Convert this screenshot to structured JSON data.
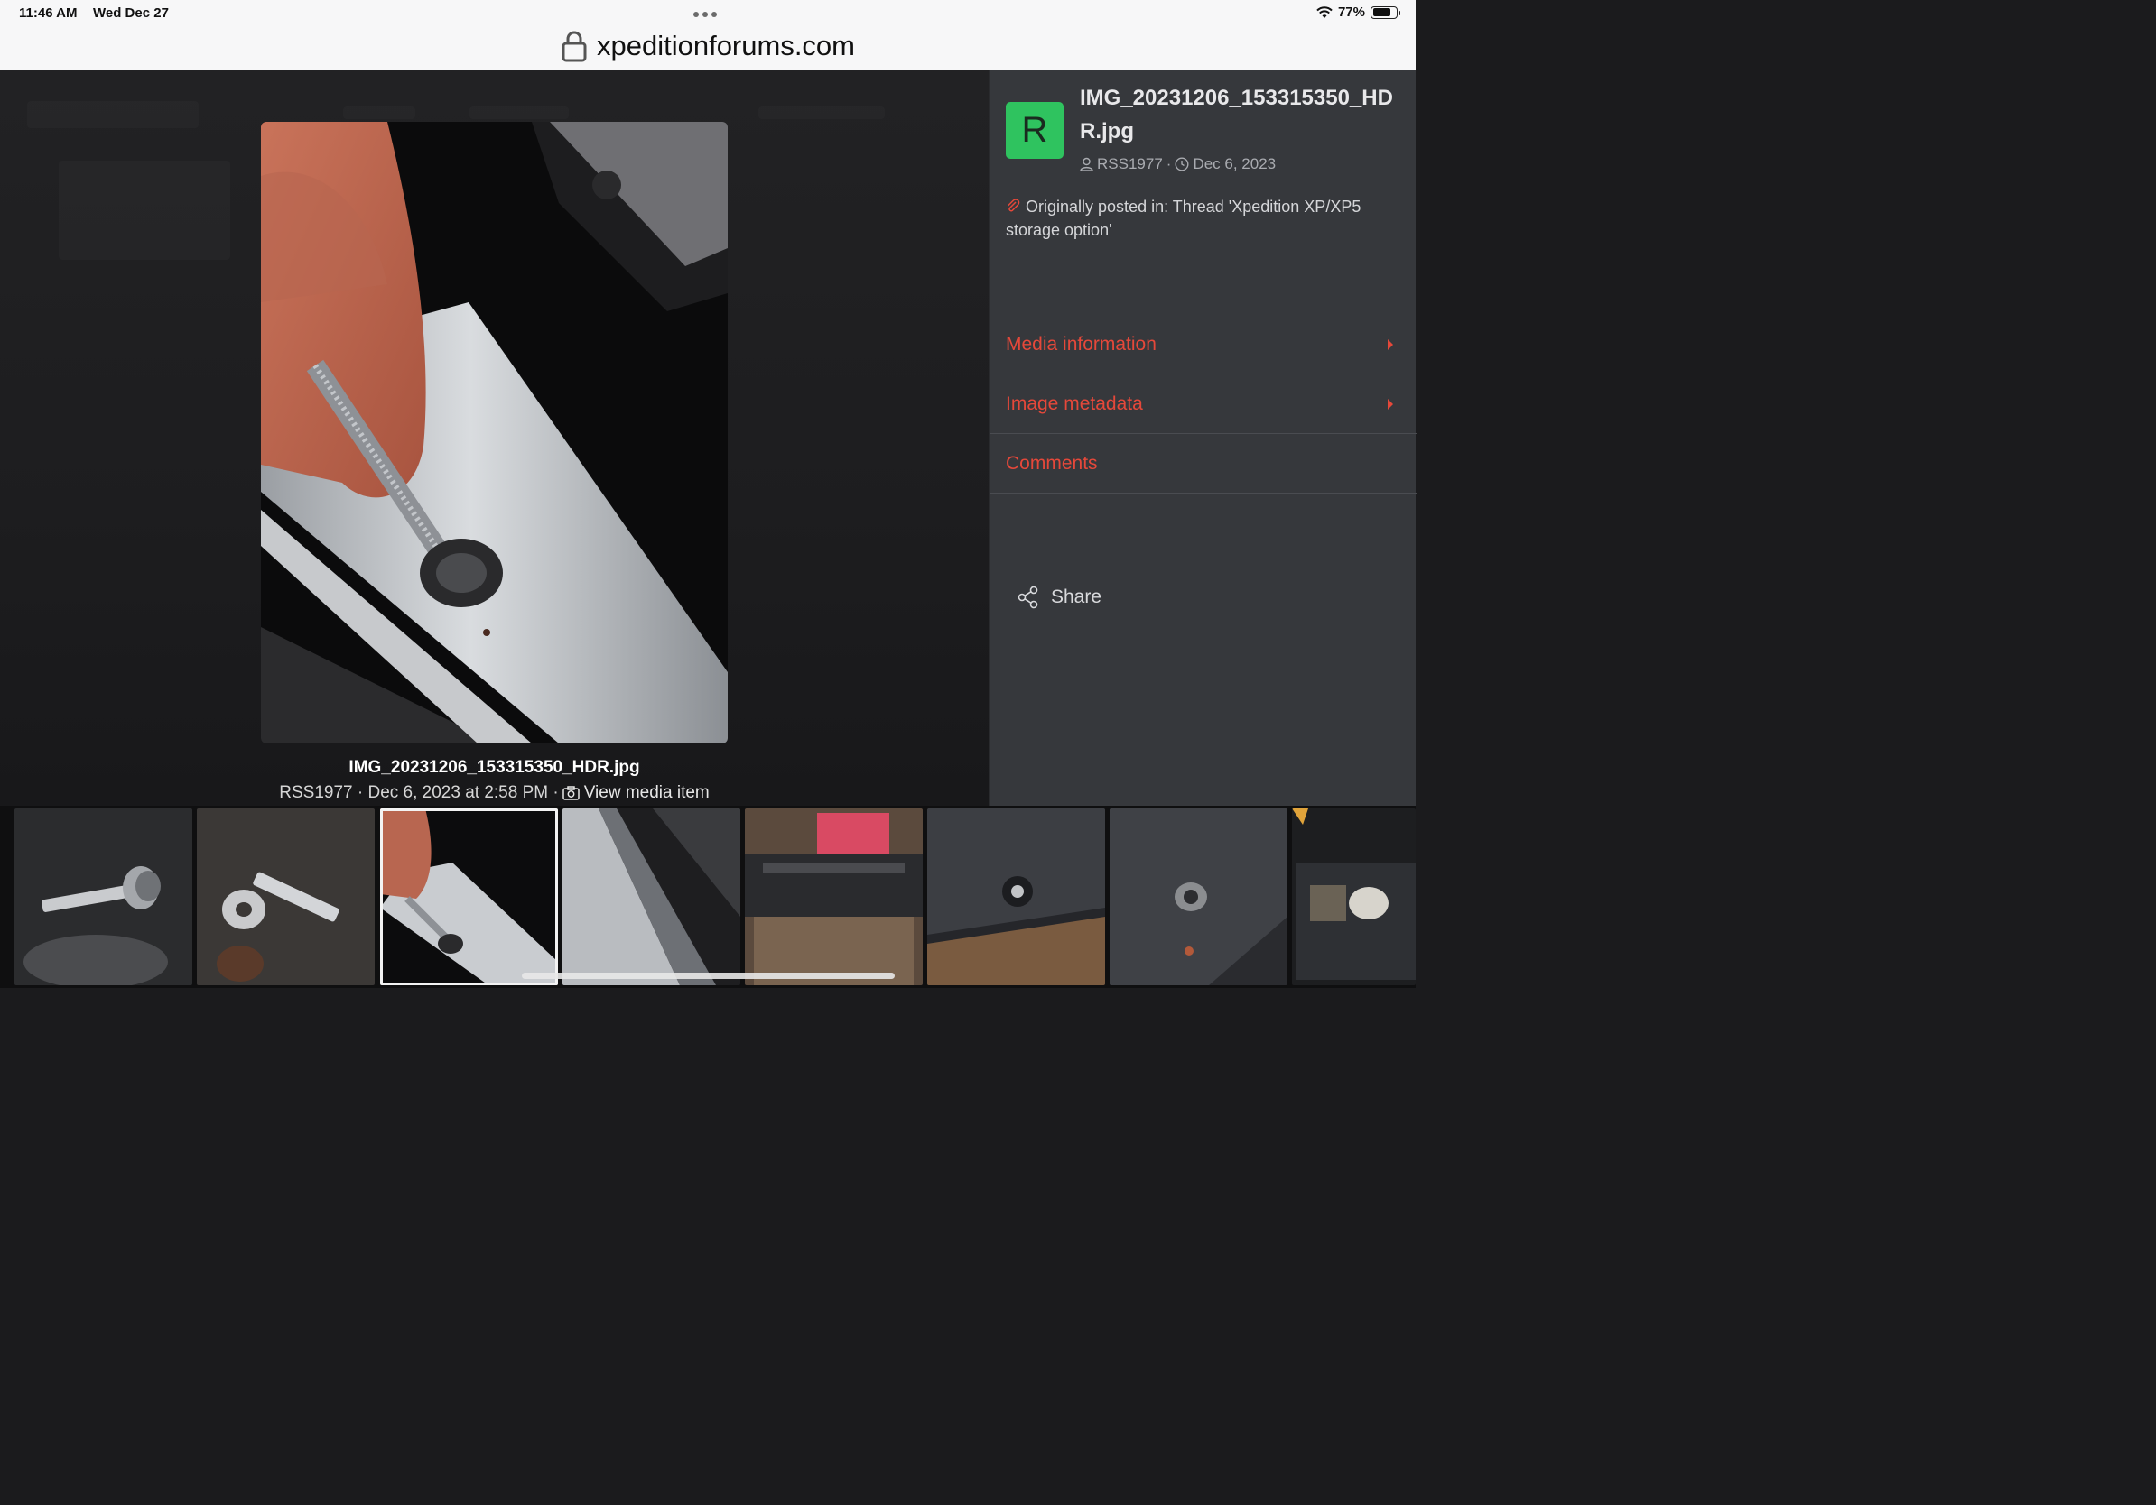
{
  "status_bar": {
    "time": "11:46 AM",
    "date": "Wed Dec 27",
    "battery": "77%"
  },
  "browser": {
    "url": "xpeditionforums.com"
  },
  "viewer": {
    "caption_title": "IMG_20231206_153315350_HDR.jpg",
    "caption_meta": "RSS1977 · Dec 6, 2023 at 2:58 PM ·",
    "view_media_label": "View media item"
  },
  "sidebar": {
    "avatar_letter": "R",
    "avatar_color": "#2fc35f",
    "title": "IMG_20231206_153315350_HDR.jpg",
    "author": "RSS1977",
    "separator": "·",
    "date": "Dec 6, 2023",
    "origin_text": "Originally posted in: Thread 'Xpedition XP/XP5 storage option'",
    "rows": [
      {
        "label": "Media information"
      },
      {
        "label": "Image metadata"
      },
      {
        "label": "Comments"
      }
    ],
    "share_label": "Share",
    "accent_color": "#e5483a"
  },
  "filmstrip": {
    "selected_index": 2,
    "thumbnails": [
      {
        "name": "thumb-bolt-washers"
      },
      {
        "name": "thumb-bolt-loose-parts"
      },
      {
        "name": "thumb-bolt-in-rail"
      },
      {
        "name": "thumb-rail-channel"
      },
      {
        "name": "thumb-storage-bed"
      },
      {
        "name": "thumb-panel-hole"
      },
      {
        "name": "thumb-panel-nut"
      },
      {
        "name": "thumb-storage-box"
      }
    ]
  }
}
